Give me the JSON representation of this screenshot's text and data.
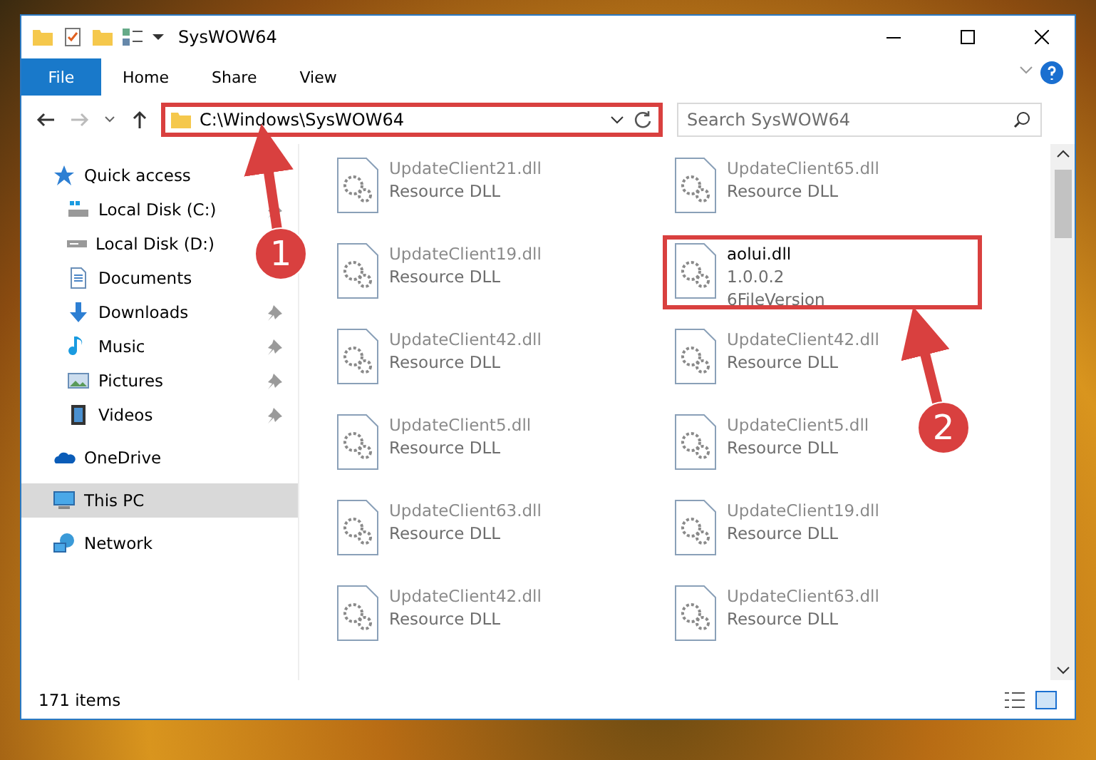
{
  "window": {
    "title": "SysWOW64"
  },
  "ribbon_tabs": [
    {
      "label": "File",
      "selected": true
    },
    {
      "label": "Home",
      "selected": false
    },
    {
      "label": "Share",
      "selected": false
    },
    {
      "label": "View",
      "selected": false
    }
  ],
  "address_bar": {
    "path": "C:\\Windows\\SysWOW64",
    "highlighted": true
  },
  "search": {
    "placeholder": "Search SysWOW64"
  },
  "sidebar": {
    "items": [
      {
        "label": "Quick access",
        "kind": "star",
        "selected": false,
        "children": [
          {
            "label": "Local Disk (C:)",
            "kind": "disk-system",
            "pinned": true
          },
          {
            "label": "Local Disk (D:)",
            "kind": "disk",
            "pinned": false
          },
          {
            "label": "Documents",
            "kind": "documents",
            "pinned": false
          },
          {
            "label": "Downloads",
            "kind": "downloads",
            "pinned": true
          },
          {
            "label": "Music",
            "kind": "music",
            "pinned": true
          },
          {
            "label": "Pictures",
            "kind": "pictures",
            "pinned": true
          },
          {
            "label": "Videos",
            "kind": "videos",
            "pinned": true
          }
        ]
      },
      {
        "label": "OneDrive",
        "kind": "cloud",
        "selected": false
      },
      {
        "label": "This PC",
        "kind": "pc",
        "selected": true
      },
      {
        "label": "Network",
        "kind": "network",
        "selected": false
      }
    ]
  },
  "files": [
    {
      "name": "UpdateClient21.dll",
      "detail": "Resource DLL",
      "blurred": true,
      "highlighted": false
    },
    {
      "name": "UpdateClient65.dll",
      "detail": "Resource DLL",
      "blurred": true,
      "highlighted": false
    },
    {
      "name": "UpdateClient19.dll",
      "detail": "Resource DLL",
      "blurred": true,
      "highlighted": false
    },
    {
      "name": "aolui.dll",
      "detail": "1.0.0.2",
      "detail_2": "6FileVersion",
      "blurred": false,
      "highlighted": true
    },
    {
      "name": "UpdateClient42.dll",
      "detail": "Resource DLL",
      "blurred": true,
      "highlighted": false
    },
    {
      "name": "UpdateClient42.dll",
      "detail": "Resource DLL",
      "blurred": true,
      "highlighted": false
    },
    {
      "name": "UpdateClient5.dll",
      "detail": "Resource DLL",
      "blurred": true,
      "highlighted": false
    },
    {
      "name": "UpdateClient5.dll",
      "detail": "Resource DLL",
      "blurred": true,
      "highlighted": false
    },
    {
      "name": "UpdateClient63.dll",
      "detail": "Resource DLL",
      "blurred": true,
      "highlighted": false
    },
    {
      "name": "UpdateClient19.dll",
      "detail": "Resource DLL",
      "blurred": true,
      "highlighted": false
    },
    {
      "name": "UpdateClient42.dll",
      "detail": "Resource DLL",
      "blurred": true,
      "highlighted": false
    },
    {
      "name": "UpdateClient63.dll",
      "detail": "Resource DLL",
      "blurred": true,
      "highlighted": false
    }
  ],
  "status_bar": {
    "count": "171 items"
  },
  "annotations": [
    {
      "label": "1"
    },
    {
      "label": "2"
    }
  ]
}
